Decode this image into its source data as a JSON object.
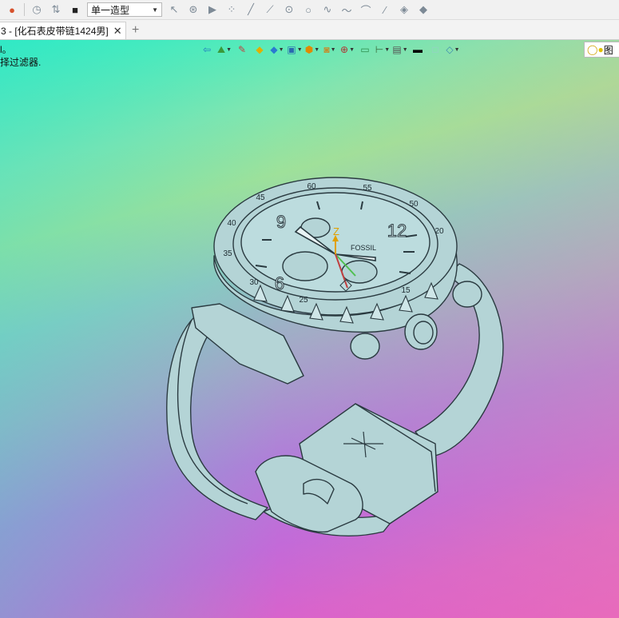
{
  "toolbar": {
    "mode_value": "单一造型",
    "icons": [
      "app-icon",
      "history-icon",
      "filter-icon",
      "stop-icon",
      "select-arrow-icon",
      "pick-icon",
      "play-icon",
      "points-icon",
      "line-icon",
      "line2-icon",
      "circle-center-icon",
      "circle-icon",
      "spline-icon",
      "curve-icon",
      "arc-icon",
      "sketch-line-icon",
      "plane-icon",
      "surface-icon"
    ]
  },
  "tab": {
    "title": "3 - [化石表皮带链1424男]",
    "close": "✕",
    "new": "+"
  },
  "messages": {
    "line1": "l。",
    "line2": "择过滤器."
  },
  "axis": {
    "z_label": "Z"
  },
  "watch": {
    "bezel_numbers": [
      "60",
      "55",
      "50",
      "45",
      "40",
      "35",
      "30",
      "25",
      "20",
      "15"
    ],
    "dial_numbers": [
      "12",
      "9",
      "6"
    ],
    "brand": "FOSSIL"
  },
  "light_box": {
    "label": "图"
  },
  "colors": {
    "model_fill": "#b4d4d6",
    "model_stroke": "#2a3a40",
    "z_axis": "#e0a000"
  }
}
